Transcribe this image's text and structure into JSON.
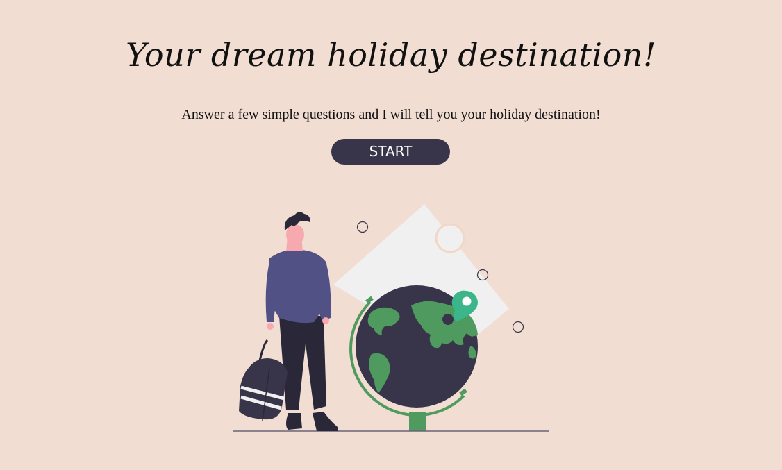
{
  "header": {
    "title": "Your dream holiday destination!",
    "subtitle": "Answer a few simple questions and I will tell you your holiday destination!"
  },
  "actions": {
    "start_label": "START"
  },
  "illustration": {
    "name": "traveler-with-globe-illustration"
  },
  "colors": {
    "background": "#f1ddd1",
    "button": "#383449",
    "button_text": "#ffffff",
    "globe_ocean": "#383449",
    "globe_land": "#4f9a5e",
    "pin": "#3bb58a",
    "shirt": "#515185",
    "pants": "#2a2838",
    "skin": "#f6aab0"
  }
}
